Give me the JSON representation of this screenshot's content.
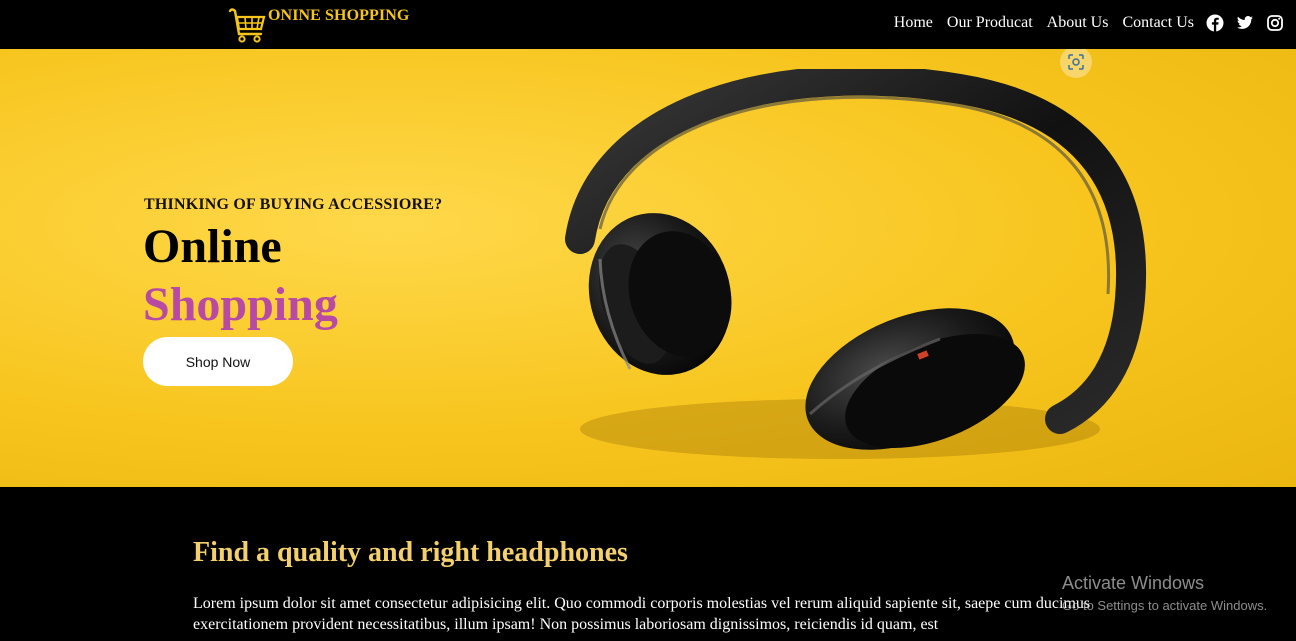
{
  "brand": {
    "name": "ONINE SHOPPING",
    "icon": "shopping-cart-icon",
    "color": "#f5c518"
  },
  "nav": {
    "links": [
      "Home",
      "Our Producat",
      "About Us",
      "Contact Us"
    ],
    "social_icons": [
      "facebook-icon",
      "twitter-icon",
      "instagram-icon"
    ]
  },
  "hero": {
    "subtitle": "THINKING OF BUYING ACCESSIORE?",
    "title_line1": "Online",
    "title_line2": "Shopping",
    "title_line2_color": "#b849a5",
    "button_label": "Shop Now",
    "background_color": "#f7c51e",
    "image": "headphones-image",
    "overlay_icon": "lens-icon"
  },
  "section": {
    "title": "Find a quality and right headphones",
    "title_color": "#f3d06b",
    "body": "Lorem ipsum dolor sit amet consectetur adipisicing elit. Quo commodi corporis molestias vel rerum aliquid sapiente sit, saepe cum ducimus exercitationem provident necessitatibus, illum ipsam! Non possimus laboriosam dignissimos, reiciendis id quam, est"
  },
  "watermark": {
    "title": "Activate Windows",
    "subtitle": "Go to Settings to activate Windows."
  }
}
